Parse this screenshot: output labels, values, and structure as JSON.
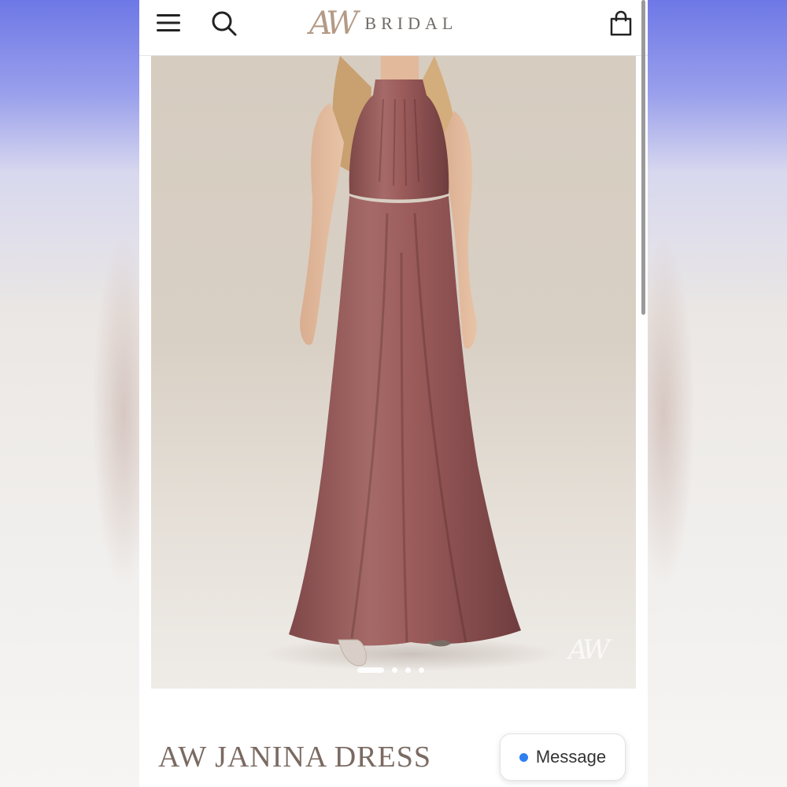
{
  "header": {
    "logo_mark": "AW",
    "logo_text": "BRIDAL",
    "icons": [
      "menu-icon",
      "search-icon",
      "shopping-bag-icon"
    ]
  },
  "gallery": {
    "watermark": "AW",
    "slide_count": 4,
    "active_slide": 1
  },
  "product": {
    "title": "AW JANINA DRESS",
    "dress_color": "#9a5a5a"
  },
  "chat": {
    "label": "Message",
    "status_color": "#2f7ff0"
  },
  "colors": {
    "accent": "#b49a86",
    "title_text": "#7a6a62"
  }
}
